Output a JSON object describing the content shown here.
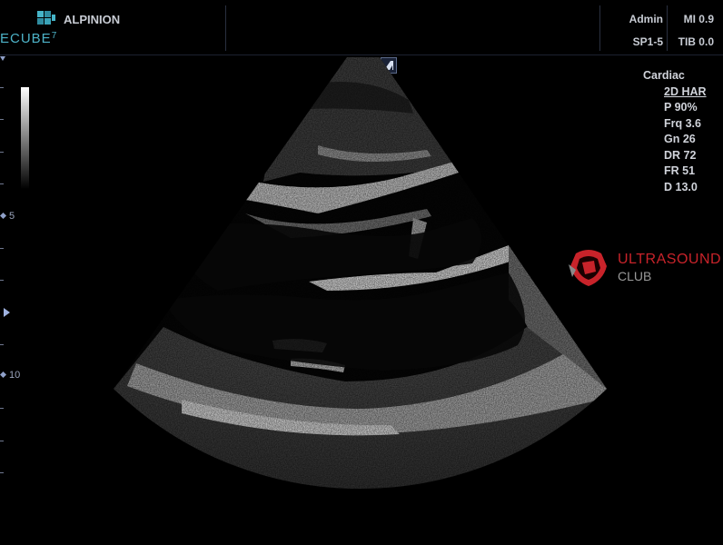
{
  "header": {
    "logo_text": "ECUBE",
    "logo_suffix": "7",
    "brand": "ALPINION",
    "user": "Admin",
    "probe": "SP1-5",
    "mi": "MI 0.9",
    "tib": "TIB 0.0"
  },
  "depth_scale": {
    "labels": [
      "5",
      "10"
    ]
  },
  "imaging_params": {
    "preset": "Cardiac",
    "mode": "2D HAR",
    "power": "P 90%",
    "frequency": "Frq 3.6",
    "gain": "Gn 26",
    "dynamic_range": "DR 72",
    "frame_rate": "FR 51",
    "depth": "D 13.0"
  },
  "watermark": {
    "line1": "ULTRASOUND",
    "line2": "CLUB",
    "color": "#c8232a"
  },
  "colors": {
    "background": "#000000",
    "text": "#c8ccd4",
    "logo_accent": "#4db3c8",
    "scale_marker": "#8fa0c8"
  }
}
